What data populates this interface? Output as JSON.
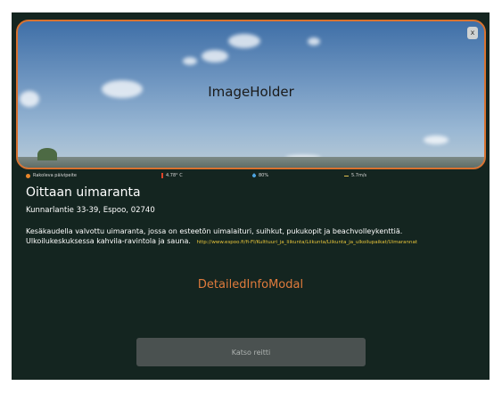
{
  "image_holder": {
    "label": "ImageHolder",
    "close_label": "x"
  },
  "stats": {
    "status": "Rakoleva päivipeite",
    "temperature": "4.78° C",
    "humidity": "80%",
    "wind": "5.7m/s"
  },
  "place": {
    "title": "Oittaan uimaranta",
    "address": "Kunnarlantie 33-39, Espoo, 02740",
    "description": "Kesäkaudella valvottu uimaranta, jossa on esteetön uimalaituri, suihkut, pukukopit ja beachvolleykenttiä. Ulkoilukeskuksessa kahvila-ravintola ja sauna.",
    "link": "http://www.espoo.fi/fi-FI/Kulttuuri_ja_liikunta/Liikunta/Liikunta_ja_ulkoilupaikat/Uimarannat"
  },
  "modal": {
    "label": "DetailedInfoModal"
  },
  "actions": {
    "route_label": "Katso reitti"
  },
  "colors": {
    "border": "#d9722f",
    "modal_bg": "#142520",
    "link": "#e8c53a",
    "button": "#4a5150"
  }
}
